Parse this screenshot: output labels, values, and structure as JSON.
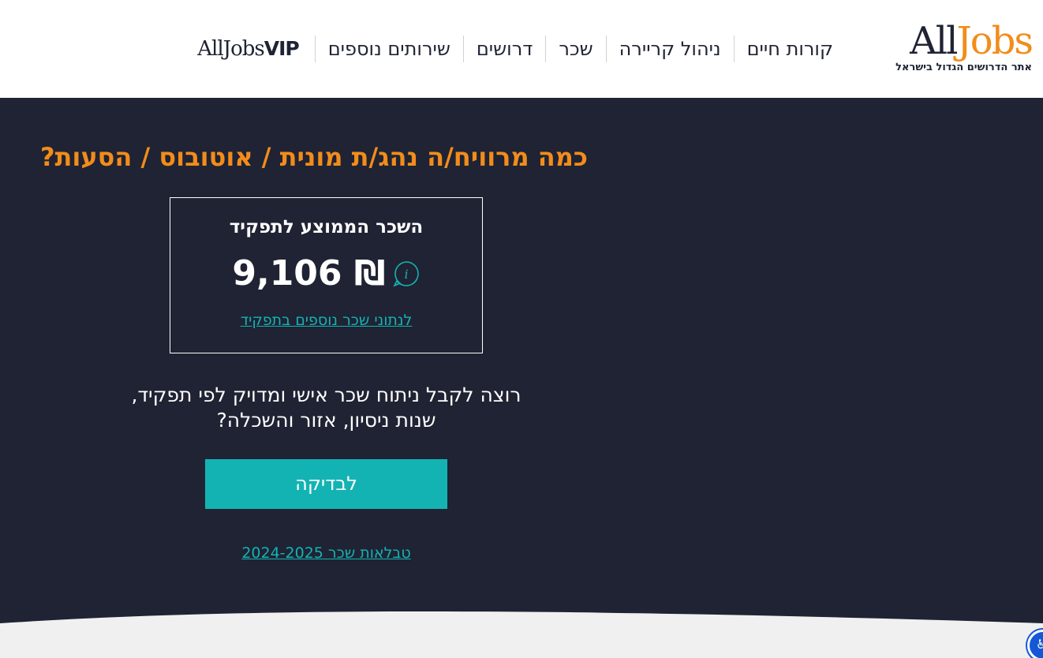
{
  "header": {
    "logo": {
      "all": "All",
      "jobs": "Jobs",
      "tagline": "אתר הדרושים הגדול בישראל"
    },
    "nav": [
      {
        "label": "קורות חיים"
      },
      {
        "label": "ניהול קריירה"
      },
      {
        "label": "שכר"
      },
      {
        "label": "דרושים"
      },
      {
        "label": "שירותים נוספים"
      }
    ],
    "vip": {
      "text": "AllJobs",
      "badge": "VIP"
    }
  },
  "main": {
    "title": "כמה מרוויח/ה נהג/ת מונית / אוטובוס / הסעות?",
    "salary_box": {
      "label": "השכר הממוצע לתפקיד",
      "value": "9,106 ₪",
      "info_icon": "info-icon",
      "more_link": "לנתוני שכר נוספים בתפקיד"
    },
    "question_line1": "רוצה לקבל ניתוח שכר אישי ומדויק לפי תפקיד,",
    "question_line2": "שנות ניסיון, אזור והשכלה?",
    "cta_label": "לבדיקה",
    "tables_link": "טבלאות שכר 2024-2025"
  },
  "colors": {
    "background": "#1f2333",
    "accent_orange": "#f28c1b",
    "accent_teal": "#14b3b3",
    "header_bg": "#ffffff"
  }
}
